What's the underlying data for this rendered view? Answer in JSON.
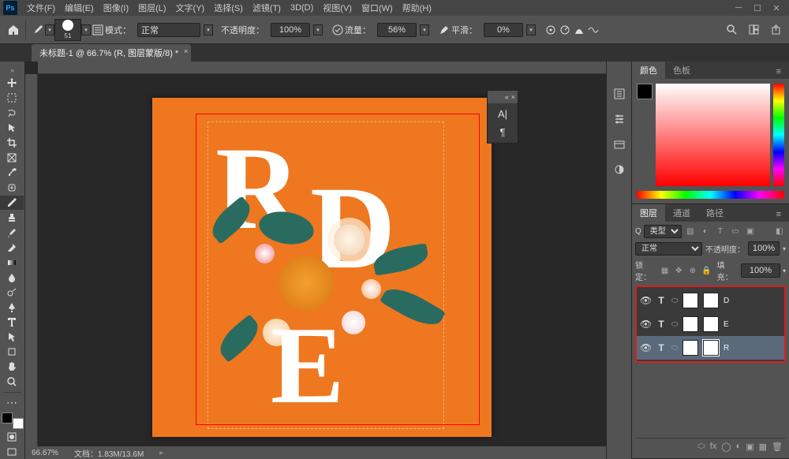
{
  "menubar": {
    "logo": "Ps",
    "items": [
      "文件(F)",
      "编辑(E)",
      "图像(I)",
      "图层(L)",
      "文字(Y)",
      "选择(S)",
      "滤镜(T)",
      "3D(D)",
      "视图(V)",
      "窗口(W)",
      "帮助(H)"
    ]
  },
  "optbar": {
    "brush_size": "51",
    "mode_label": "模式：",
    "mode_value": "正常",
    "opacity_label": "不透明度：",
    "opacity_value": "100%",
    "flow_label": "流量：",
    "flow_value": "56%",
    "smooth_label": "平滑：",
    "smooth_value": "0%"
  },
  "tab": {
    "title": "未标题-1 @ 66.7% (R, 图层蒙版/8) *"
  },
  "char_panel": {
    "a_icon": "A|",
    "pilcrow": "¶"
  },
  "status": {
    "zoom": "66.67%",
    "doc_label": "文档：",
    "doc_size": "1.83M/13.6M"
  },
  "panels": {
    "color_tabs": [
      "颜色",
      "色板"
    ],
    "layer_tabs": [
      "图层",
      "通道",
      "路径"
    ],
    "filter_prefix": "Q",
    "filter_value": "类型",
    "blend_value": "正常",
    "opacity_label": "不透明度：",
    "opacity_value": "100%",
    "lock_label": "锁定：",
    "fill_label": "填充：",
    "fill_value": "100%",
    "layers": [
      {
        "type": "T",
        "name": "D"
      },
      {
        "type": "T",
        "name": "E"
      },
      {
        "type": "T",
        "name": "R"
      }
    ]
  },
  "canvas": {
    "letters": [
      "R",
      "D",
      "E"
    ]
  }
}
